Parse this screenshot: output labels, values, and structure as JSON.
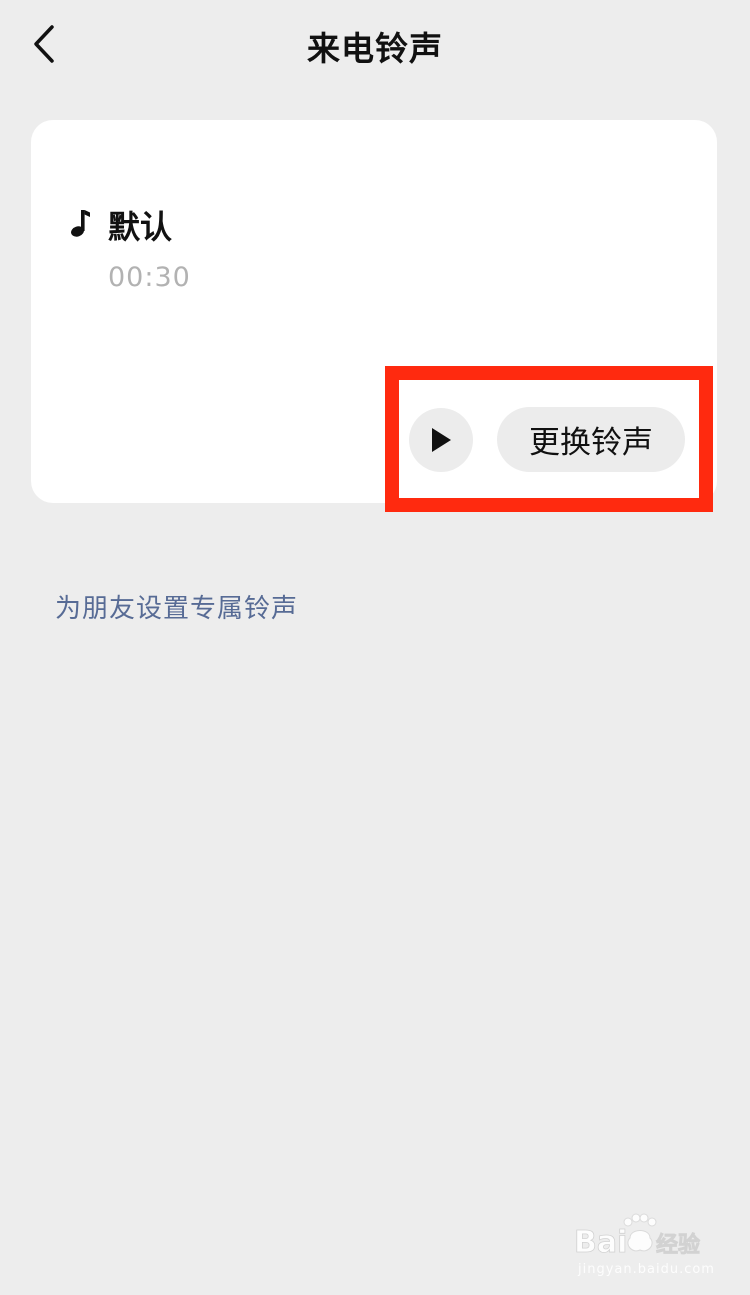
{
  "header": {
    "title": "来电铃声"
  },
  "ringtone": {
    "name": "默认",
    "duration": "00:30",
    "icon": "music-note-icon"
  },
  "actions": {
    "play_icon": "play-icon",
    "change_label": "更换铃声"
  },
  "friend_ringtone": {
    "link_label": "为朋友设置专属铃声"
  },
  "watermark": {
    "text": "Baidu经验",
    "sub": "jingyan.baidu.com"
  },
  "colors": {
    "background": "#ededed",
    "card": "#ffffff",
    "link": "#576b95",
    "highlight": "#ff2a0f",
    "muted_text": "#b2b2b2",
    "button_bg": "#ececec"
  }
}
